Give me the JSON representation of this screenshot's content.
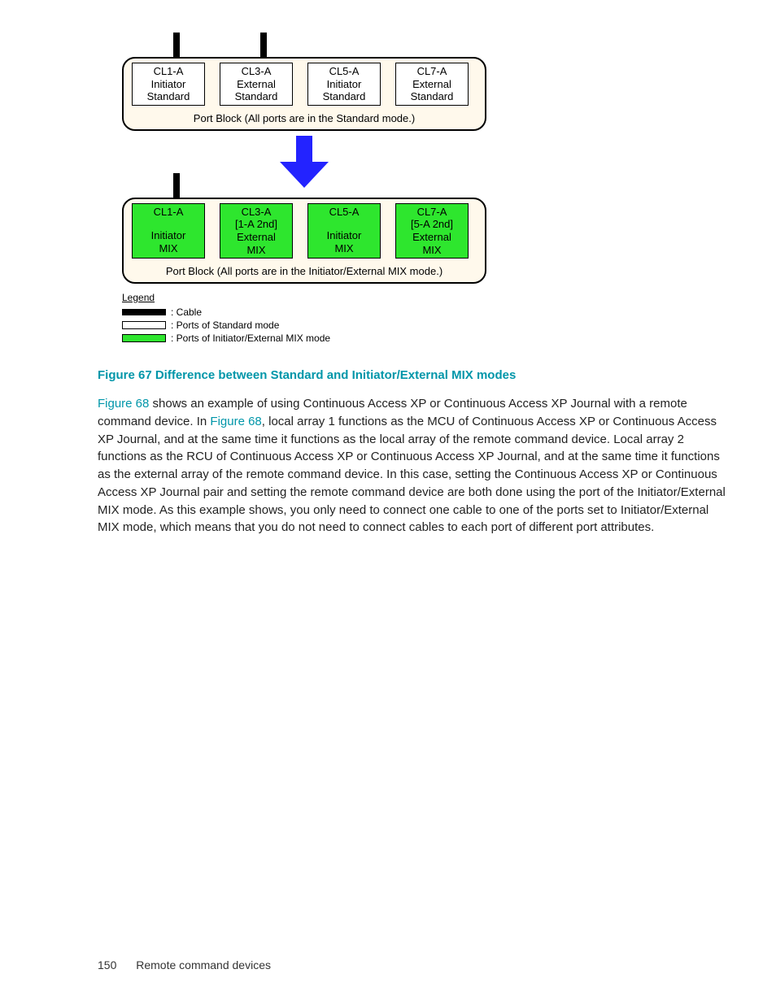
{
  "diagram": {
    "block1": {
      "ports": [
        {
          "name": "CL1-A",
          "role": "Initiator",
          "mode": "Standard"
        },
        {
          "name": "CL3-A",
          "role": "External",
          "mode": "Standard"
        },
        {
          "name": "CL5-A",
          "role": "Initiator",
          "mode": "Standard"
        },
        {
          "name": "CL7-A",
          "role": "External",
          "mode": "Standard"
        }
      ],
      "caption": "Port Block (All ports are in the Standard mode.)"
    },
    "block2": {
      "ports": [
        {
          "name": "CL1-A",
          "sub": "",
          "role": "Initiator",
          "mode": "MIX"
        },
        {
          "name": "CL3-A",
          "sub": "[1-A 2nd]",
          "role": "External",
          "mode": "MIX"
        },
        {
          "name": "CL5-A",
          "sub": "",
          "role": "Initiator",
          "mode": "MIX"
        },
        {
          "name": "CL7-A",
          "sub": "[5-A 2nd]",
          "role": "External",
          "mode": "MIX"
        }
      ],
      "caption": "Port Block (All ports are in the Initiator/External MIX mode.)"
    },
    "legend": {
      "title": "Legend",
      "cable": ": Cable",
      "standard": ": Ports of Standard mode",
      "mix": ": Ports of Initiator/External MIX mode"
    }
  },
  "figure_caption": "Figure 67 Difference between Standard and Initiator/External MIX modes",
  "paragraph": {
    "link1": "Figure 68",
    "t1": " shows an example of using Continuous Access XP or Continuous Access XP Journal with a remote command device. In ",
    "link2": "Figure 68",
    "t2": ", local array 1 functions as the MCU of Continuous Access XP or Continuous Access XP Journal, and at the same time it functions as the local array of the remote command device. Local array 2 functions as the RCU of Continuous Access XP or Continuous Access XP Journal, and at the same time it functions as the external array of the remote command device. In this case, setting the Continuous Access XP or Continuous Access XP Journal pair and setting the remote command device are both done using the port of the Initiator/External MIX mode. As this example shows, you only need to connect one cable to one of the ports set to Initiator/External MIX mode, which means that you do not need to connect cables to each port of different port attributes."
  },
  "footer": {
    "page": "150",
    "section": "Remote command devices"
  }
}
